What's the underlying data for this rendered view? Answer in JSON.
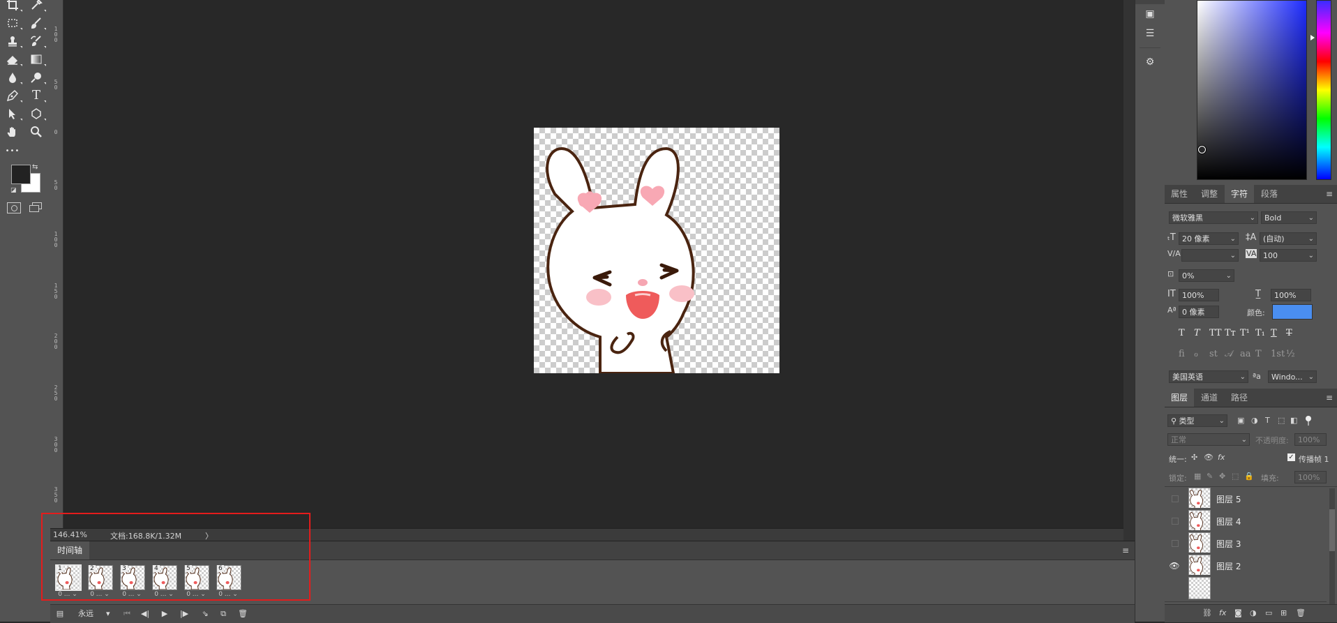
{
  "toolbar": {
    "tools": [
      {
        "name": "crop-icon",
        "glyph": "⌗"
      },
      {
        "name": "eyedropper-icon",
        "glyph": "✎"
      },
      {
        "name": "marquee-icon",
        "glyph": "⬚"
      },
      {
        "name": "brush-icon",
        "glyph": "🖌"
      },
      {
        "name": "stamp-icon",
        "glyph": "⊥"
      },
      {
        "name": "history-brush-icon",
        "glyph": "✐"
      },
      {
        "name": "eraser-icon",
        "glyph": "⌫"
      },
      {
        "name": "gradient-icon",
        "glyph": "■"
      },
      {
        "name": "blur-icon",
        "glyph": "💧"
      },
      {
        "name": "dodge-icon",
        "glyph": "⚲"
      },
      {
        "name": "pen-icon",
        "glyph": "✒"
      },
      {
        "name": "type-icon",
        "glyph": "T"
      },
      {
        "name": "path-select-icon",
        "glyph": "➤"
      },
      {
        "name": "shape-icon",
        "glyph": "⬡"
      },
      {
        "name": "hand-icon",
        "glyph": "✋"
      },
      {
        "name": "zoom-icon",
        "glyph": "🔍"
      },
      {
        "name": "more-tools-icon",
        "glyph": "•••"
      }
    ],
    "foreground_color": "#222222",
    "background_color": "#ffffff"
  },
  "ruler": {
    "labels": [
      "100",
      "50",
      "0",
      "50",
      "100",
      "150",
      "200",
      "250",
      "300",
      "350"
    ]
  },
  "status": {
    "zoom": "146.41%",
    "doc_info": "文档:168.8K/1.32M",
    "arrow": "〉"
  },
  "timeline": {
    "tab_label": "时间轴",
    "frames": [
      {
        "num": "1",
        "delay": "0 ...",
        "selected": true
      },
      {
        "num": "2",
        "delay": "0 ...",
        "selected": false
      },
      {
        "num": "3",
        "delay": "0 ...",
        "selected": false
      },
      {
        "num": "4",
        "delay": "0 ...",
        "selected": false
      },
      {
        "num": "5",
        "delay": "0 ...",
        "selected": false
      },
      {
        "num": "6",
        "delay": "0 ...",
        "selected": false
      }
    ],
    "loop_value": "永远"
  },
  "character_panel": {
    "tabs": [
      "属性",
      "调整",
      "字符",
      "段落"
    ],
    "active_tab": "字符",
    "font_family": "微软雅黑",
    "font_style": "Bold",
    "font_size": "20 像素",
    "leading": "(自动)",
    "kerning": "",
    "tracking": "100",
    "scale_percent": "0%",
    "vertical_scale": "100%",
    "horizontal_scale": "100%",
    "baseline_shift": "0 像素",
    "color_label": "颜色:",
    "color_value": "#4a8ef0",
    "style_glyphs": [
      "T",
      "T",
      "TT",
      "Tт",
      "T¹",
      "T₁",
      "T",
      "T"
    ],
    "opentype_glyphs": [
      "ﬁ",
      "ℴ",
      "st",
      "𝒜",
      "aa",
      "T",
      "1st",
      "½"
    ],
    "language": "美国英语",
    "aa_label": "ªa",
    "antialias": "Windo..."
  },
  "layers_panel": {
    "tabs": [
      "图层",
      "通道",
      "路径"
    ],
    "active_tab": "图层",
    "filter": "类型",
    "blend_mode": "正常",
    "opacity_label": "不透明度:",
    "opacity_value": "100%",
    "unify_label": "统一:",
    "propagate_label": "传播帧 1",
    "lock_label": "锁定:",
    "fill_label": "填充:",
    "fill_value": "100%",
    "layers": [
      {
        "name": "图层 5",
        "visible": false
      },
      {
        "name": "图层 4",
        "visible": false
      },
      {
        "name": "图层 3",
        "visible": false
      },
      {
        "name": "图层 2",
        "visible": true
      }
    ]
  },
  "colors": {
    "highlight": "#e41c1c",
    "canvas_bg": "#282828",
    "panel_bg": "#535353"
  }
}
